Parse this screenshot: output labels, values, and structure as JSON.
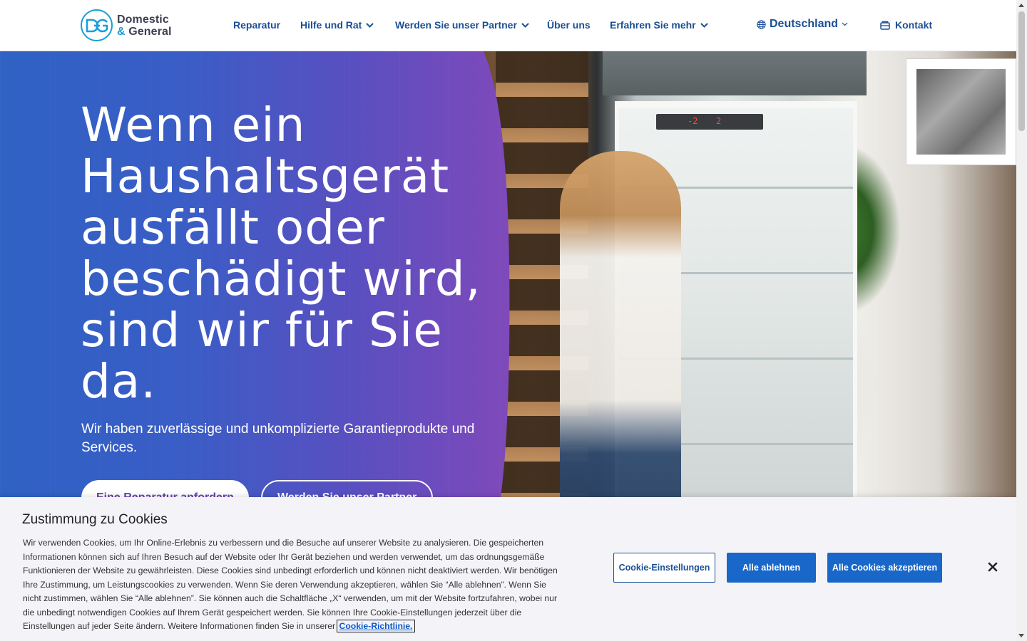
{
  "brand": {
    "name_line1": "Domestic",
    "name_line2_amp": "&",
    "name_line2": " General",
    "logo_icon": "dg-logo-icon",
    "accent_color": "#1a9fd9",
    "nav_color": "#1b4f94"
  },
  "nav": {
    "items": [
      {
        "label": "Reparatur",
        "has_dropdown": false
      },
      {
        "label": "Hilfe und Rat",
        "has_dropdown": true
      },
      {
        "label": "Werden Sie unser Partner",
        "has_dropdown": true
      },
      {
        "label": "Über uns",
        "has_dropdown": false
      },
      {
        "label": "Erfahren Sie mehr",
        "has_dropdown": true
      }
    ],
    "country": {
      "label": "Deutschland",
      "icon": "globe-icon"
    },
    "contact": {
      "label": "Kontakt",
      "icon": "contact-icon"
    }
  },
  "hero": {
    "title": "Wenn ein Haushaltsgerät ausfällt oder beschädigt wird, sind wir für Sie da.",
    "subtitle": "Wir haben zuverlässige und unkomplizierte Garantieprodukte und Services.",
    "primary_button": "Eine Reparatur anfordern",
    "secondary_button": "Werden Sie unser Partner",
    "fridge_display_left": "-2",
    "fridge_display_right": "2",
    "gradient_start": "#2f62c4",
    "gradient_end": "#8e47b6"
  },
  "cookie": {
    "title": "Zustimmung zu Cookies",
    "text": "Wir verwenden Cookies, um Ihr Online-Erlebnis zu verbessern und die Besuche auf unserer Website zu analysieren. Die gespeicherten Informationen können sich auf Ihren Besuch auf der Website oder Ihr Gerät beziehen und werden verwendet, um das ordnungsgemäße Funktionieren der Website zu gewährleisten. Diese Cookies sind unbedingt erforderlich und können nicht deaktiviert werden. Wir benötigen Ihre Zustimmung, um Leistungscookies zu verwenden. Wenn Sie deren Verwendung akzeptieren, wählen Sie “Alle ablehnen”. Wenn Sie nicht zustimmen, wählen Sie “Alle ablehnen”. Sie können auch die Schaltfläche „X“ verwenden, um mit der Website fortzufahren, wobei nur die unbedingt notwendigen Cookies auf Ihrem Gerät gespeichert werden. Sie können Ihre Cookie-Einstellungen jederzeit über die Einstellungen auf jeder Seite ändern. Weitere Informationen finden Sie in unserer",
    "link": "Cookie-Richtlinie.",
    "settings_button": "Cookie-Einstellungen",
    "reject_button": "Alle ablehnen",
    "accept_button": "Alle Cookies akzeptieren",
    "close_icon": "close-icon",
    "button_color": "#1967c8"
  }
}
